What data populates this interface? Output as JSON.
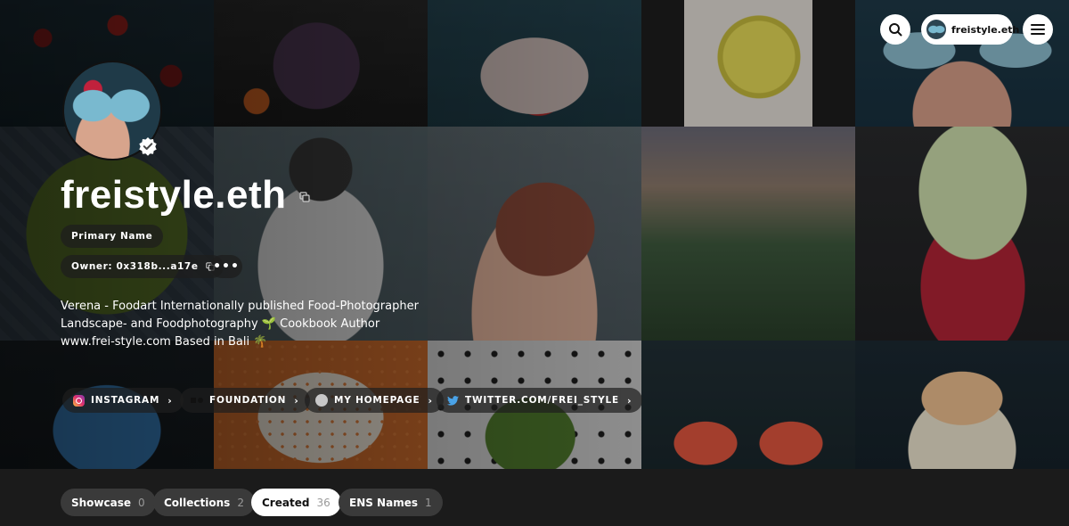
{
  "header": {
    "user_name": "freistyle.eth",
    "search_icon": "search-icon",
    "menu_icon": "hamburger-menu-icon"
  },
  "profile": {
    "name": "freistyle.eth",
    "primary_name_label": "Primary Name",
    "owner_label": "Owner: 0x318b...a17e",
    "more_label": "•••",
    "verified_icon": "verified-badge-icon",
    "bio": "Verena - Foodart Internationally published Food-Photographer Landscape- and Foodphotography 🌱 Cookbook Author www.frei-style.com Based in Bali 🌴"
  },
  "links": [
    {
      "label": "INSTAGRAM",
      "icon": "instagram-icon"
    },
    {
      "label": "FOUNDATION",
      "icon": "foundation-icon"
    },
    {
      "label": "MY HOMEPAGE",
      "icon": "globe-icon"
    },
    {
      "label": "TWITTER.COM/FREI_STYLE",
      "icon": "twitter-icon"
    }
  ],
  "tabs": [
    {
      "label": "Showcase",
      "count": "0",
      "active": false
    },
    {
      "label": "Collections",
      "count": "2",
      "active": false
    },
    {
      "label": "Created",
      "count": "36",
      "active": true
    },
    {
      "label": "ENS Names",
      "count": "1",
      "active": false
    }
  ],
  "colors": {
    "tab_bar_bg": "#1b1b1b",
    "tab_active_bg": "#ffffff",
    "tab_inactive_bg": "#3a3a3a",
    "twitter": "#4aa3e8"
  }
}
